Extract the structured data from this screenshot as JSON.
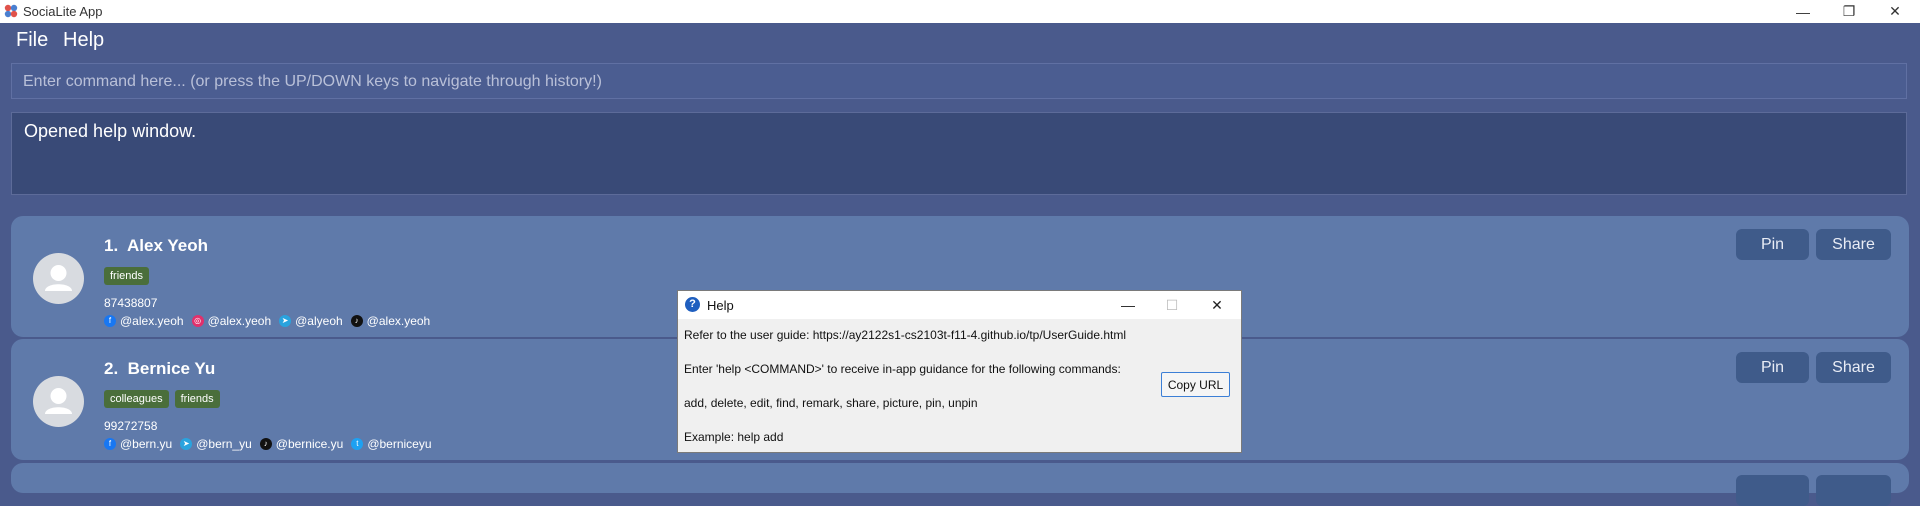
{
  "window": {
    "title": "SociaLite App",
    "controls": {
      "minimize": "—",
      "maximize": "❐",
      "close": "✕"
    }
  },
  "menu": {
    "file": "File",
    "help": "Help"
  },
  "command": {
    "placeholder": "Enter command here... (or press the UP/DOWN keys to navigate through history!)"
  },
  "result": {
    "text": "Opened help window."
  },
  "persons": [
    {
      "index": "1.",
      "name": "Alex Yeoh",
      "tags": [
        "friends"
      ],
      "phone": "87438807",
      "socials": [
        {
          "icon": "facebook-icon",
          "handle": "@alex.yeoh"
        },
        {
          "icon": "instagram-icon",
          "handle": "@alex.yeoh"
        },
        {
          "icon": "telegram-icon",
          "handle": "@alyeoh"
        },
        {
          "icon": "tiktok-icon",
          "handle": "@alex.yeoh"
        }
      ],
      "pin": "Pin",
      "share": "Share"
    },
    {
      "index": "2.",
      "name": "Bernice Yu",
      "tags": [
        "colleagues",
        "friends"
      ],
      "phone": "99272758",
      "socials": [
        {
          "icon": "facebook-icon",
          "handle": "@bern.yu"
        },
        {
          "icon": "telegram-icon",
          "handle": "@bern_yu"
        },
        {
          "icon": "tiktok-icon",
          "handle": "@bernice.yu"
        },
        {
          "icon": "twitter-icon",
          "handle": "@berniceyu"
        }
      ],
      "pin": "Pin",
      "share": "Share"
    }
  ],
  "help_dialog": {
    "title": "Help",
    "guide": "Refer to the user guide: https://ay2122s1-cs2103t-f11-4.github.io/tp/UserGuide.html",
    "instruction": "Enter 'help <COMMAND>' to receive in-app guidance for the following commands:",
    "commands": "add, delete, edit, find, remark, share, picture, pin, unpin",
    "example": "Example: help add",
    "copy_button": "Copy URL"
  }
}
